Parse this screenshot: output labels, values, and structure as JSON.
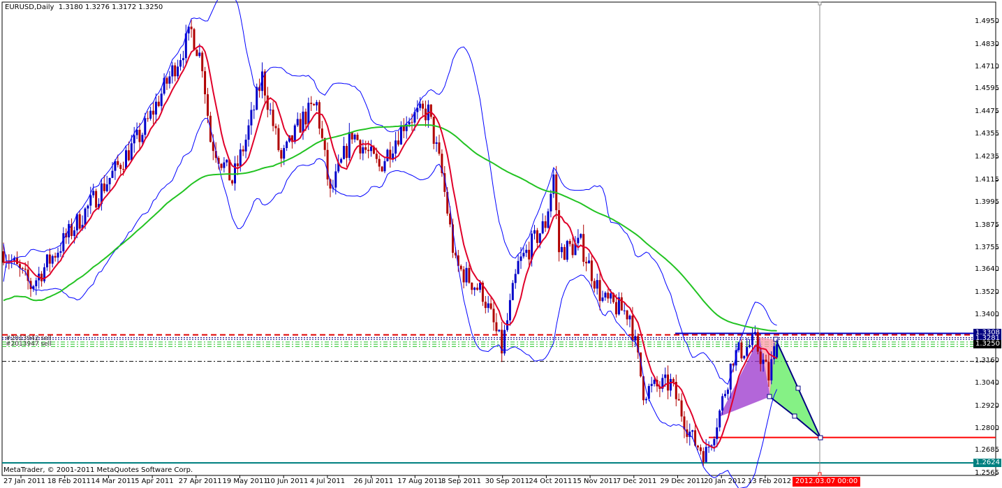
{
  "header": {
    "symbol_timeframe": "EURUSD,Daily",
    "ohlc": "1.3180 1.3276 1.3172 1.3250"
  },
  "footer": {
    "copyright": "MetaTrader, © 2001-2011 MetaQuotes Software Corp."
  },
  "orders": [
    "#2013942 sell",
    "#2013947 sell"
  ],
  "cursor_time": "2012.03.07 00:00",
  "colors": {
    "bull": "#0000c8",
    "bear": "#b00000",
    "ma_fast": "#e0002a",
    "ma_slow": "#22c322",
    "bands": "#0000ff",
    "cursor_box": "#ff0000"
  },
  "chart_data": {
    "type": "candlestick",
    "symbol": "EURUSD",
    "timeframe": "Daily",
    "ylim": [
      1.2565,
      1.495
    ],
    "y_ticks": [
      "1.4950",
      "1.4830",
      "1.4710",
      "1.4595",
      "1.4475",
      "1.4355",
      "1.4235",
      "1.4115",
      "1.3995",
      "1.3875",
      "1.3755",
      "1.3640",
      "1.3520",
      "1.3400",
      "1.3160",
      "1.3040",
      "1.2920",
      "1.2800",
      "1.2685",
      "1.2565"
    ],
    "x_ticks": [
      "27 Jan 2011",
      "18 Feb 2011",
      "14 Mar 2011",
      "5 Apr 2011",
      "27 Apr 2011",
      "19 May 2011",
      "10 Jun 2011",
      "4 Jul 2011",
      "26 Jul 2011",
      "17 Aug 2011",
      "8 Sep 2011",
      "30 Sep 2011",
      "24 Oct 2011",
      "15 Nov 2011",
      "7 Dec 2011",
      "29 Dec 2011",
      "20 Jan 2012",
      "13 Feb 2012"
    ],
    "price_path_keypoints": [
      [
        0,
        1.3741
      ],
      [
        10,
        1.3557
      ],
      [
        25,
        1.3852
      ],
      [
        38,
        1.411
      ],
      [
        51,
        1.4368
      ],
      [
        61,
        1.4662
      ],
      [
        69,
        1.4902
      ],
      [
        73,
        1.4736
      ],
      [
        76,
        1.4331
      ],
      [
        84,
        1.411
      ],
      [
        89,
        1.4331
      ],
      [
        95,
        1.4662
      ],
      [
        102,
        1.422
      ],
      [
        110,
        1.4441
      ],
      [
        115,
        1.4515
      ],
      [
        120,
        1.4036
      ],
      [
        128,
        1.4368
      ],
      [
        138,
        1.4183
      ],
      [
        148,
        1.4441
      ],
      [
        156,
        1.4478
      ],
      [
        161,
        1.4146
      ],
      [
        166,
        1.3667
      ],
      [
        176,
        1.352
      ],
      [
        183,
        1.3225
      ],
      [
        189,
        1.3667
      ],
      [
        199,
        1.3888
      ],
      [
        202,
        1.4146
      ],
      [
        204,
        1.3741
      ],
      [
        212,
        1.3778
      ],
      [
        220,
        1.3483
      ],
      [
        230,
        1.3409
      ],
      [
        235,
        1.3004
      ],
      [
        245,
        1.3041
      ],
      [
        253,
        1.2746
      ],
      [
        258,
        1.2672
      ],
      [
        263,
        1.2893
      ],
      [
        268,
        1.3188
      ],
      [
        276,
        1.3262
      ],
      [
        281,
        1.3078
      ],
      [
        284,
        1.3273
      ]
    ],
    "last_bar": {
      "open": 1.318,
      "high": 1.3276,
      "low": 1.3172,
      "close": 1.325
    },
    "price_labels": [
      {
        "value": "1.3308",
        "color": "#000080"
      },
      {
        "value": "1.3281",
        "color": "#000080"
      },
      {
        "value": "1.3250",
        "color": "#000000"
      },
      {
        "value": "1.2624",
        "color": "#008080"
      }
    ],
    "levels": [
      {
        "price": 1.33,
        "color": "#e00000",
        "style": "dash-thick"
      },
      {
        "price": 1.3285,
        "color": "#000080",
        "style": "dot"
      },
      {
        "price": 1.3276,
        "color": "#000080",
        "style": "dot"
      },
      {
        "price": 1.3262,
        "color": "#22c322",
        "style": "dashdot"
      },
      {
        "price": 1.325,
        "color": "#22c322",
        "style": "dashdot"
      },
      {
        "price": 1.3238,
        "color": "#22c322",
        "style": "dashdot"
      },
      {
        "price": 1.316,
        "color": "#000000",
        "style": "dashdot"
      },
      {
        "price": 1.2624,
        "color": "#008080",
        "style": "solid"
      }
    ],
    "indicators": [
      "SMA fast (red)",
      "SMA slow (green)",
      "Bollinger Bands (blue)"
    ]
  }
}
